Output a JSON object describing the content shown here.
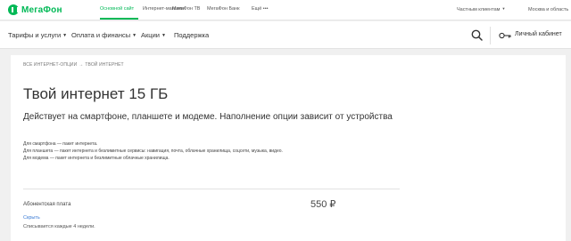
{
  "brand": {
    "name": "МегаФон",
    "color": "#00b956"
  },
  "top_nav": {
    "links": [
      {
        "label": "Основной сайт",
        "active": true
      },
      {
        "label": "Интернет-магазин",
        "active": false
      },
      {
        "label": "МегаФон ТВ",
        "active": false
      },
      {
        "label": "МегаФон Банк",
        "active": false
      },
      {
        "label": "Ещё •••",
        "active": false
      }
    ],
    "audience_selector": "Частным клиентам",
    "region_selector": "Москва и область"
  },
  "main_nav": {
    "items": [
      {
        "label": "Тарифы и услуги",
        "dropdown": true
      },
      {
        "label": "Оплата и финансы",
        "dropdown": true
      },
      {
        "label": "Акции",
        "dropdown": true
      },
      {
        "label": "Поддержка",
        "dropdown": false
      }
    ],
    "search_icon": "search-icon",
    "account_icon": "key-icon",
    "account_label": "Личный кабинет"
  },
  "breadcrumb": {
    "parent": "ВСЕ ИНТЕРНЕТ-ОПЦИИ",
    "separator": "→",
    "current": "ТВОЙ ИНТЕРНЕТ"
  },
  "page": {
    "title": "Твой интернет 15 ГБ",
    "subtitle": "Действует на смартфоне, планшете и модеме. Наполнение опции зависит от устройства",
    "description": [
      "Для смартфона — пакет интернета.",
      "Для планшета — пакет интернета и безлимитные сервисы: навигация, почта, облачные хранилища, соцсети, музыка, видео.",
      "Для модема — пакет интернета и безлимитные облачные хранилища."
    ],
    "fee": {
      "label": "Абонентская плата",
      "price": "550 ₽",
      "toggle_label": "Скрыть",
      "note": "Списывается каждые 4 недели."
    }
  }
}
